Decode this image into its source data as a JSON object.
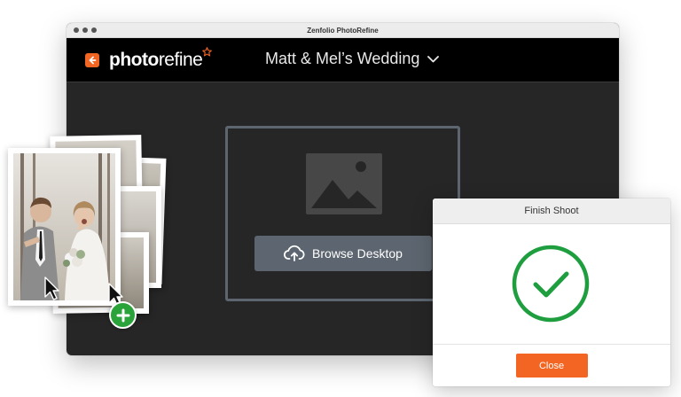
{
  "window": {
    "title": "Zenfolio PhotoRefine"
  },
  "header": {
    "back_icon": "arrow-left-icon",
    "logo_part1": "photo",
    "logo_part2": "refine",
    "project_name": "Matt & Mel’s Wedding",
    "brand_color": "#f26522"
  },
  "upload": {
    "placeholder_icon": "image-placeholder-icon",
    "browse_label": "Browse Desktop",
    "browse_icon": "cloud-upload-icon"
  },
  "photo_stack": {
    "add_icon": "plus-icon",
    "add_color": "#2aa33b"
  },
  "dialog": {
    "title": "Finish Shoot",
    "status_icon": "check-circle-icon",
    "status_color": "#1e9e3e",
    "close_label": "Close"
  }
}
